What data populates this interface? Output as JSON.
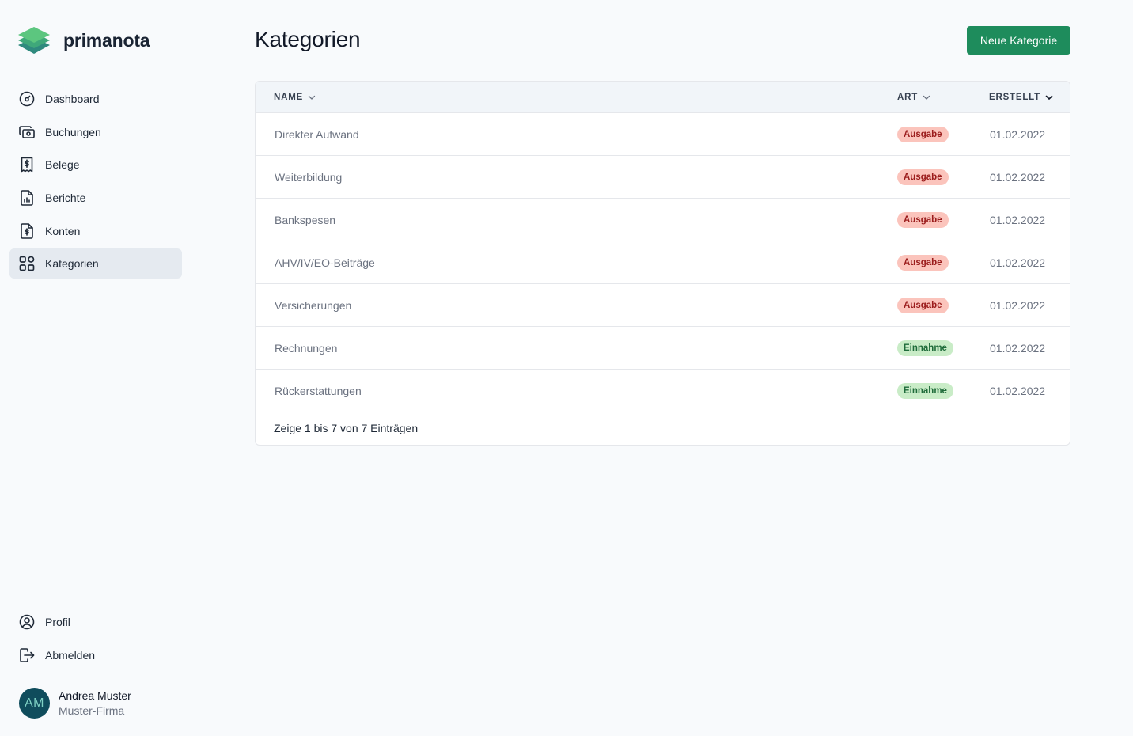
{
  "app": {
    "name": "primanota"
  },
  "sidebar": {
    "items": [
      {
        "label": "Dashboard",
        "icon": "gauge-icon"
      },
      {
        "label": "Buchungen",
        "icon": "cash-icon"
      },
      {
        "label": "Belege",
        "icon": "receipt-icon"
      },
      {
        "label": "Berichte",
        "icon": "report-icon"
      },
      {
        "label": "Konten",
        "icon": "account-document-icon"
      },
      {
        "label": "Kategorien",
        "icon": "grid-icon",
        "active": true
      }
    ],
    "bottom_items": [
      {
        "label": "Profil",
        "icon": "user-circle-icon"
      },
      {
        "label": "Abmelden",
        "icon": "logout-icon"
      }
    ],
    "user": {
      "initials": "AM",
      "name": "Andrea Muster",
      "company": "Muster-Firma"
    }
  },
  "main": {
    "title": "Kategorien",
    "new_button": "Neue Kategorie",
    "table": {
      "columns": [
        "NAME",
        "ART",
        "ERSTELLT"
      ],
      "rows": [
        {
          "name": "Direkter Aufwand",
          "type": "Ausgabe",
          "created": "01.02.2022"
        },
        {
          "name": "Weiterbildung",
          "type": "Ausgabe",
          "created": "01.02.2022"
        },
        {
          "name": "Bankspesen",
          "type": "Ausgabe",
          "created": "01.02.2022"
        },
        {
          "name": "AHV/IV/EO-Beiträge",
          "type": "Ausgabe",
          "created": "01.02.2022"
        },
        {
          "name": "Versicherungen",
          "type": "Ausgabe",
          "created": "01.02.2022"
        },
        {
          "name": "Rechnungen",
          "type": "Einnahme",
          "created": "01.02.2022"
        },
        {
          "name": "Rückerstattungen",
          "type": "Einnahme",
          "created": "01.02.2022"
        }
      ],
      "footer": "Zeige 1 bis 7 von 7 Einträgen"
    }
  },
  "colors": {
    "primary": "#1e8c5c",
    "expense_bg": "#fbc4bc",
    "expense_text": "#9b1c1c",
    "income_bg": "#c9ecc7",
    "income_text": "#1f6b3a",
    "avatar_bg": "#0f4c5c"
  }
}
